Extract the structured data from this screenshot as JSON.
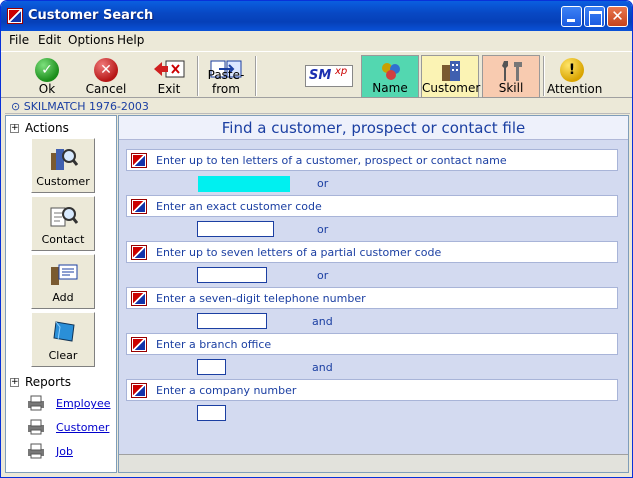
{
  "window": {
    "title": "Customer Search"
  },
  "menu": [
    {
      "label": "File"
    },
    {
      "label": "Edit"
    },
    {
      "label": "Options"
    },
    {
      "label": "Help"
    }
  ],
  "toolbar": {
    "ok": "Ok",
    "cancel": "Cancel",
    "exit": "Exit",
    "paste_from": "Paste-from",
    "logo": "SM",
    "logo_sup": "xp",
    "name": "Name",
    "customer": "Customer",
    "skill": "Skill",
    "attention": "Attention"
  },
  "version_bar": "⊙ SKILMATCH 1976-2003",
  "actions": {
    "heading": "Actions",
    "buttons": [
      {
        "label": "Customer"
      },
      {
        "label": "Contact"
      },
      {
        "label": "Add"
      },
      {
        "label": "Clear"
      }
    ]
  },
  "reports": {
    "heading": "Reports",
    "links": [
      {
        "label": "Employee"
      },
      {
        "label": "Customer"
      },
      {
        "label": "Job"
      }
    ]
  },
  "main": {
    "title": "Find a customer, prospect or contact file",
    "rows": [
      {
        "prompt": "Enter up to ten letters of a customer, prospect or contact name",
        "value": "",
        "conj": "or"
      },
      {
        "prompt": "Enter an exact customer code",
        "value": "",
        "conj": "or"
      },
      {
        "prompt": "Enter up to seven letters of a partial customer code",
        "value": "",
        "conj": "or"
      },
      {
        "prompt": "Enter a seven-digit telephone number",
        "value": "",
        "conj": "and"
      },
      {
        "prompt": "Enter a branch office",
        "value": "",
        "conj": "and"
      },
      {
        "prompt": "Enter a company number",
        "value": "",
        "conj": ""
      }
    ]
  }
}
